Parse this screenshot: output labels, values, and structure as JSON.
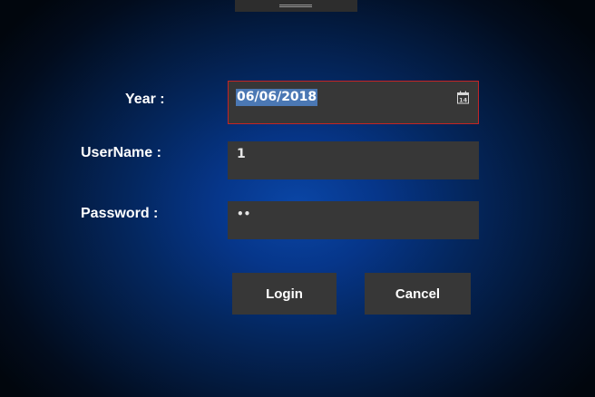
{
  "form": {
    "year_label": "Year :",
    "username_label": "UserName :",
    "password_label": "Password :",
    "year_value": "06/06/2018",
    "username_value": "1",
    "password_value": "••",
    "calendar_icon": "calendar-icon",
    "calendar_day": "14"
  },
  "buttons": {
    "login_label": "Login",
    "cancel_label": "Cancel"
  },
  "colors": {
    "field_background": "#373737",
    "date_field_border": "#c42525",
    "selection_highlight": "#4b78b4",
    "background_center": "#0a46a6",
    "background_edge": "#01060d"
  }
}
